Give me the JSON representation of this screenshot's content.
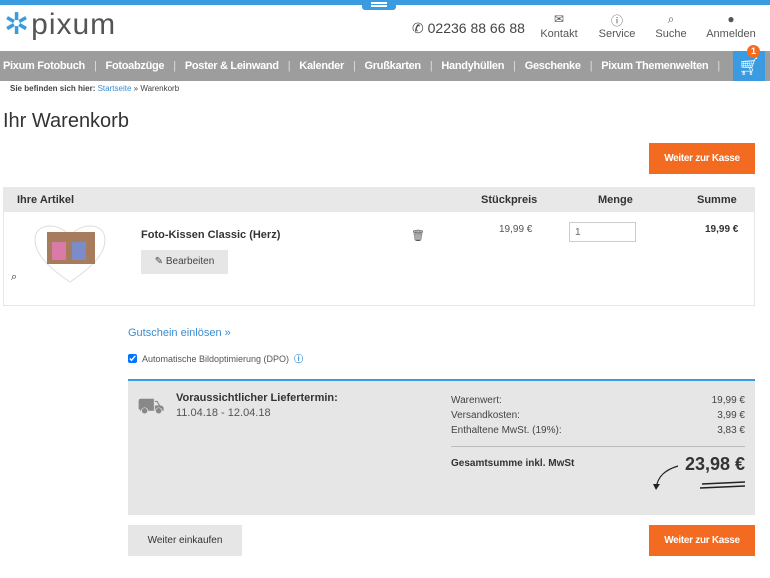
{
  "header": {
    "logo": "pixum",
    "phone": "02236 88 66 88",
    "icons": [
      {
        "label": "Kontakt",
        "icon": "mail-icon"
      },
      {
        "label": "Service",
        "icon": "help-icon"
      },
      {
        "label": "Suche",
        "icon": "search-icon"
      },
      {
        "label": "Anmelden",
        "icon": "user-icon"
      }
    ],
    "cart_count": "1"
  },
  "nav": [
    "Pixum Fotobuch",
    "Fotoabzüge",
    "Poster & Leinwand",
    "Kalender",
    "Grußkarten",
    "Handyhüllen",
    "Geschenke",
    "Pixum Themenwelten"
  ],
  "breadcrumb": {
    "prefix": "Sie befinden sich hier:",
    "home": "Startseite",
    "sep": "»",
    "current": "Warenkorb"
  },
  "title": "Ihr Warenkorb",
  "checkout_label": "Weiter zur Kasse",
  "table": {
    "headers": {
      "article": "Ihre Artikel",
      "unit_price": "Stückpreis",
      "qty": "Menge",
      "sum": "Summe"
    },
    "items": [
      {
        "name": "Foto-Kissen Classic (Herz)",
        "edit": "Bearbeiten",
        "unit_price": "19,99 €",
        "qty": "1",
        "sum": "19,99 €"
      }
    ]
  },
  "voucher": "Gutschein einlösen »",
  "dpo": {
    "label": "Automatische Bildoptimierung (DPO)",
    "checked": true
  },
  "summary": {
    "delivery_label": "Voraussichtlicher Liefertermin:",
    "delivery_dates": "11.04.18 - 12.04.18",
    "lines": [
      {
        "label": "Warenwert:",
        "value": "19,99 €"
      },
      {
        "label": "Versandkosten:",
        "value": "3,99 €"
      },
      {
        "label": "Enthaltene MwSt. (19%):",
        "value": "3,83 €"
      }
    ],
    "total_label": "Gesamtsumme inkl. MwSt",
    "total": "23,98 €"
  },
  "continue_label": "Weiter einkaufen",
  "colors": {
    "accent": "#3a9be0",
    "orange": "#f26b21"
  }
}
